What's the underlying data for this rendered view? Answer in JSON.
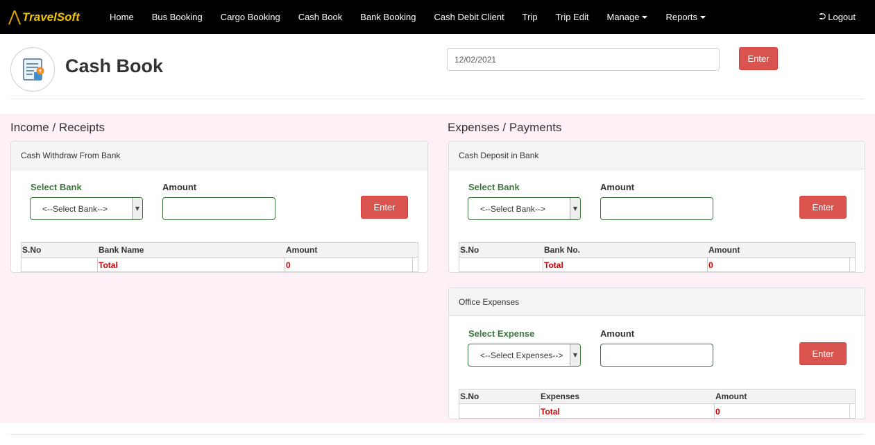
{
  "nav": {
    "brand": "TravelSoft",
    "items": [
      {
        "label": "Home",
        "dropdown": false
      },
      {
        "label": "Bus Booking",
        "dropdown": false
      },
      {
        "label": "Cargo Booking",
        "dropdown": false
      },
      {
        "label": "Cash Book",
        "dropdown": false
      },
      {
        "label": "Bank Booking",
        "dropdown": false
      },
      {
        "label": "Cash Debit Client",
        "dropdown": false
      },
      {
        "label": "Trip",
        "dropdown": false
      },
      {
        "label": "Trip Edit",
        "dropdown": false
      },
      {
        "label": "Manage",
        "dropdown": true
      },
      {
        "label": "Reports",
        "dropdown": true
      }
    ],
    "logout": "Logout"
  },
  "header": {
    "title": "Cash Book",
    "date": "12/02/2021",
    "enter": "Enter"
  },
  "income": {
    "title": "Income / Receipts",
    "withdraw": {
      "heading": "Cash Withdraw From Bank",
      "select_label": "Select Bank",
      "select_value": "<--Select Bank-->",
      "amount_label": "Amount",
      "enter": "Enter",
      "columns": [
        "S.No",
        "Bank Name",
        "Amount"
      ],
      "total_label": "Total",
      "total_value": "0"
    }
  },
  "expenses": {
    "title": "Expenses / Payments",
    "deposit": {
      "heading": "Cash Deposit in Bank",
      "select_label": "Select Bank",
      "select_value": "<--Select Bank-->",
      "amount_label": "Amount",
      "enter": "Enter",
      "columns": [
        "S.No",
        "Bank No.",
        "Amount"
      ],
      "total_label": "Total",
      "total_value": "0"
    },
    "office": {
      "heading": "Office Expenses",
      "select_label": "Select Expense",
      "select_value": "<--Select Expenses-->",
      "amount_label": "Amount",
      "enter": "Enter",
      "columns": [
        "S.No",
        "Expenses",
        "Amount"
      ],
      "total_label": "Total",
      "total_value": "0"
    }
  },
  "colors": {
    "navbar": "#000000",
    "brand": "#f2c200",
    "accent_red": "#d9534f",
    "label_green": "#3c763d",
    "total_red": "#d40000",
    "band": "#fdf0f7"
  }
}
